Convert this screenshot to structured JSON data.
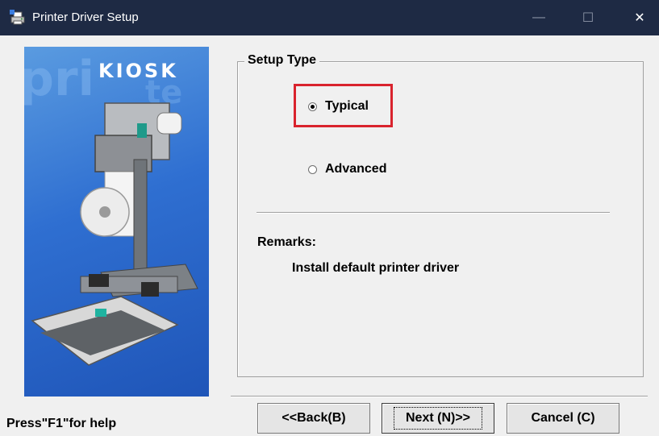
{
  "window": {
    "title": "Printer Driver Setup",
    "icons": {
      "app": "printer-setup-icon",
      "minimize": "minimize-icon",
      "maximize": "maximize-icon",
      "close": "close-icon"
    }
  },
  "side_image": {
    "brand_text": "KIOSK"
  },
  "setup": {
    "group_title": "Setup Type",
    "options": [
      {
        "label": "Typical",
        "selected": true
      },
      {
        "label": "Advanced",
        "selected": false
      }
    ],
    "remarks_title": "Remarks:",
    "remarks_text": "Install default printer driver"
  },
  "footer": {
    "help_text": "Press\"F1\"for help",
    "back_label": "<<Back(B)",
    "next_label": "Next (N)>>",
    "cancel_label": "Cancel (C)"
  },
  "colors": {
    "titlebar": "#1e2a44",
    "highlight": "#d9232d",
    "image_blue": "#2f6fd1"
  }
}
